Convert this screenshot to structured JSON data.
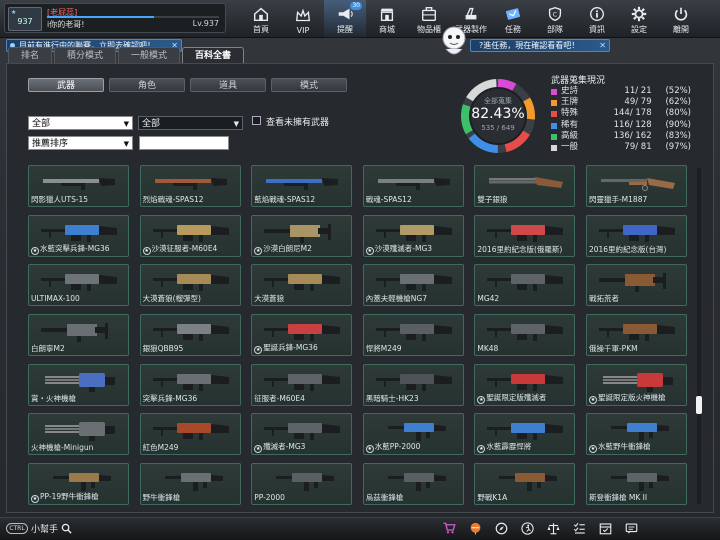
{
  "profile": {
    "name": "[老屁蕊]",
    "motto": "i你的老哥!",
    "level_text": "Lv.937",
    "avatar_level": "937",
    "xp_progress": 0.62
  },
  "nav": [
    {
      "label": "首頁",
      "icon": "home-icon"
    },
    {
      "label": "VIP",
      "icon": "crown-icon"
    },
    {
      "label": "提醒",
      "icon": "megaphone-icon",
      "badge": "30",
      "active": true
    },
    {
      "label": "商城",
      "icon": "shop-icon"
    },
    {
      "label": "物品櫃",
      "icon": "locker-icon"
    },
    {
      "label": "武器製作",
      "icon": "forge-icon"
    },
    {
      "label": "任務",
      "icon": "ticket-icon"
    },
    {
      "label": "部隊",
      "icon": "clan-icon"
    },
    {
      "label": "資訊",
      "icon": "info-icon"
    },
    {
      "label": "設定",
      "icon": "gear-icon"
    },
    {
      "label": "離開",
      "icon": "power-icon"
    }
  ],
  "notices": {
    "left": "目前有進行中的聯賽，立即去確認吧！",
    "right": "?進任務，現在確認看看吧！"
  },
  "tabs_primary": [
    {
      "label": "排名"
    },
    {
      "label": "積分模式"
    },
    {
      "label": "一般模式"
    },
    {
      "label": "百科全書",
      "active": true
    }
  ],
  "tabs_secondary": [
    {
      "label": "武器",
      "active": true
    },
    {
      "label": "角色"
    },
    {
      "label": "道具"
    },
    {
      "label": "模式"
    }
  ],
  "filters": {
    "category": "全部",
    "subcategory": "全部",
    "sort": "推薦排序",
    "search_value": "",
    "show_unowned_label": "查看未擁有武器"
  },
  "stats": {
    "title": "武器蒐集現況",
    "donut_label": "全部蒐集",
    "donut_percent": "82.43%",
    "donut_count": "535 / 649",
    "donut_fraction": 0.8243,
    "rows": [
      {
        "name": "史詩",
        "value": "11/ 21",
        "pct": "(52%)",
        "color": "#d94bd6",
        "fraction": 0.52
      },
      {
        "name": "王牌",
        "value": "49/ 79",
        "pct": "(62%)",
        "color": "#f39a2b",
        "fraction": 0.62
      },
      {
        "name": "特殊",
        "value": "144/ 178",
        "pct": "(80%)",
        "color": "#e84b4b",
        "fraction": 0.8
      },
      {
        "name": "稀有",
        "value": "116/ 128",
        "pct": "(90%)",
        "color": "#3f8fe8",
        "fraction": 0.9
      },
      {
        "name": "高級",
        "value": "136/ 162",
        "pct": "(83%)",
        "color": "#3cc06a",
        "fraction": 0.83
      },
      {
        "name": "一般",
        "value": "79/ 81",
        "pct": "(97%)",
        "color": "#d8d8d8",
        "fraction": 0.97
      }
    ]
  },
  "weapons": [
    {
      "name": "閃影獵人UTS-15",
      "medal": false,
      "kind": "shotgun",
      "tint": "#8a8f94"
    },
    {
      "name": "烈焰戰魂-SPAS12",
      "medal": false,
      "kind": "shotgun",
      "tint": "#a05a3a"
    },
    {
      "name": "藍焰戰魂-SPAS12",
      "medal": false,
      "kind": "shotgun",
      "tint": "#3b6fc4"
    },
    {
      "name": "戰魂-SPAS12",
      "medal": false,
      "kind": "shotgun",
      "tint": "#7a7f84"
    },
    {
      "name": "雙子銀狼",
      "medal": false,
      "kind": "doublebarrel",
      "tint": "#8b5a3a"
    },
    {
      "name": "閃靈獵手-M1887",
      "medal": false,
      "kind": "lever",
      "tint": "#9a6a44"
    },
    {
      "name": "水藍突擊兵鋒-MG36",
      "medal": true,
      "kind": "mg",
      "tint": "#3f7fd0"
    },
    {
      "name": "沙漠征服者-M60E4",
      "medal": true,
      "kind": "mg",
      "tint": "#b89a5c"
    },
    {
      "name": "沙漠白朗尼M2",
      "medal": true,
      "kind": "heavy",
      "tint": "#a89464"
    },
    {
      "name": "沙漠殲滅者-MG3",
      "medal": true,
      "kind": "mg",
      "tint": "#b09a66"
    },
    {
      "name": "2016里約紀念版(俄羅斯)",
      "medal": false,
      "kind": "mg",
      "tint": "#d04848"
    },
    {
      "name": "2016里約紀念版(台灣)",
      "medal": false,
      "kind": "mg",
      "tint": "#3f66c8"
    },
    {
      "name": "ULTIMAX-100",
      "medal": false,
      "kind": "mg",
      "tint": "#6e7378"
    },
    {
      "name": "大漠蒼狼(榴彈型)",
      "medal": false,
      "kind": "mg",
      "tint": "#a68a58"
    },
    {
      "name": "大漠蒼狼",
      "medal": false,
      "kind": "mg",
      "tint": "#a68a58"
    },
    {
      "name": "內蓋夫輕機槍NG7",
      "medal": false,
      "kind": "mg",
      "tint": "#6a6f74"
    },
    {
      "name": "MG42",
      "medal": false,
      "kind": "mg",
      "tint": "#5e6368"
    },
    {
      "name": "戰拓荒者",
      "medal": false,
      "kind": "heavy",
      "tint": "#8a5a34"
    },
    {
      "name": "白朗寧M2",
      "medal": false,
      "kind": "heavy",
      "tint": "#6a6f74"
    },
    {
      "name": "銀狼QBB95",
      "medal": false,
      "kind": "mg",
      "tint": "#7c8186"
    },
    {
      "name": "聖誕兵鋒-MG36",
      "medal": true,
      "kind": "mg",
      "tint": "#c84040"
    },
    {
      "name": "悍將M249",
      "medal": false,
      "kind": "mg",
      "tint": "#5a5f64"
    },
    {
      "name": "MK48",
      "medal": false,
      "kind": "mg",
      "tint": "#5e6368"
    },
    {
      "name": "俄操千軍-PKM",
      "medal": false,
      "kind": "mg",
      "tint": "#8a5a34"
    },
    {
      "name": "賞・火神機槍",
      "medal": false,
      "kind": "gatling",
      "tint": "#4a6fc0"
    },
    {
      "name": "突擊兵鋒-MG36",
      "medal": false,
      "kind": "mg",
      "tint": "#6a6f74"
    },
    {
      "name": "征服者-M60E4",
      "medal": false,
      "kind": "mg",
      "tint": "#5e6368"
    },
    {
      "name": "黑暗騎士-HK23",
      "medal": false,
      "kind": "mg",
      "tint": "#4e5358"
    },
    {
      "name": "聖誕限定版殲滅者",
      "medal": true,
      "kind": "mg",
      "tint": "#c83a3a"
    },
    {
      "name": "聖誕限定版火神機槍",
      "medal": true,
      "kind": "gatling",
      "tint": "#c83a3a"
    },
    {
      "name": "火神機槍-Minigun",
      "medal": false,
      "kind": "gatling",
      "tint": "#6a6f74"
    },
    {
      "name": "紅色M249",
      "medal": false,
      "kind": "mg",
      "tint": "#a84a2a"
    },
    {
      "name": "殲滅者-MG3",
      "medal": true,
      "kind": "mg",
      "tint": "#5e6368"
    },
    {
      "name": "水藍PP-2000",
      "medal": true,
      "kind": "smg",
      "tint": "#3f7fd0"
    },
    {
      "name": "水藍霹靂悍將",
      "medal": true,
      "kind": "mg",
      "tint": "#3f7fd0"
    },
    {
      "name": "水藍野牛衝鋒槍",
      "medal": true,
      "kind": "smg",
      "tint": "#3f7fd0"
    },
    {
      "name": "PP-19野牛衝鋒槍",
      "medal": true,
      "kind": "smg",
      "tint": "#9a7a4a"
    },
    {
      "name": "野牛衝鋒槍",
      "medal": false,
      "kind": "smg",
      "tint": "#6a6f74"
    },
    {
      "name": "PP-2000",
      "medal": false,
      "kind": "smg",
      "tint": "#5a5f64"
    },
    {
      "name": "烏茲衝鋒槍",
      "medal": false,
      "kind": "smg",
      "tint": "#5a5f64"
    },
    {
      "name": "野戰K1A",
      "medal": false,
      "kind": "smg",
      "tint": "#8a5a34"
    },
    {
      "name": "斯登衝鋒槍 MK II",
      "medal": false,
      "kind": "smg",
      "tint": "#5e6368"
    }
  ],
  "bottom": {
    "helper_label": "小幫手",
    "helper_pill": "CTRL"
  },
  "bottom_icons": [
    "cart-icon",
    "balloon-icon",
    "compass-icon",
    "runner-icon",
    "balance-icon",
    "checklist-icon",
    "calendar-icon",
    "chat-icon"
  ]
}
